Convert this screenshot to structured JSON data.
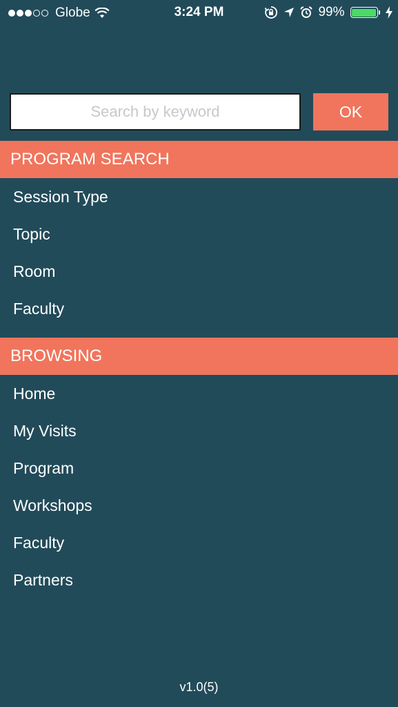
{
  "status_bar": {
    "signal_filled": 3,
    "signal_total": 5,
    "carrier": "Globe",
    "time": "3:24 PM",
    "battery_percent": "99%",
    "battery_level": 0.99,
    "battery_color": "#4cd964",
    "icons": [
      "wifi-icon",
      "orientation-lock-icon",
      "location-arrow-icon",
      "alarm-icon",
      "battery-icon",
      "charging-bolt-icon"
    ]
  },
  "search": {
    "placeholder": "Search by keyword",
    "value": "",
    "ok_label": "OK"
  },
  "program_search": {
    "header": "PROGRAM SEARCH",
    "items": [
      {
        "label": "Session Type"
      },
      {
        "label": "Topic"
      },
      {
        "label": "Room"
      },
      {
        "label": "Faculty"
      }
    ]
  },
  "browsing": {
    "header": "BROWSING",
    "items": [
      {
        "label": "Home"
      },
      {
        "label": "My Visits"
      },
      {
        "label": "Program"
      },
      {
        "label": "Workshops"
      },
      {
        "label": "Faculty"
      },
      {
        "label": "Partners"
      }
    ]
  },
  "version": "v1.0(5)",
  "colors": {
    "background": "#224b5a",
    "accent": "#f0755c",
    "text": "#ffffff"
  }
}
